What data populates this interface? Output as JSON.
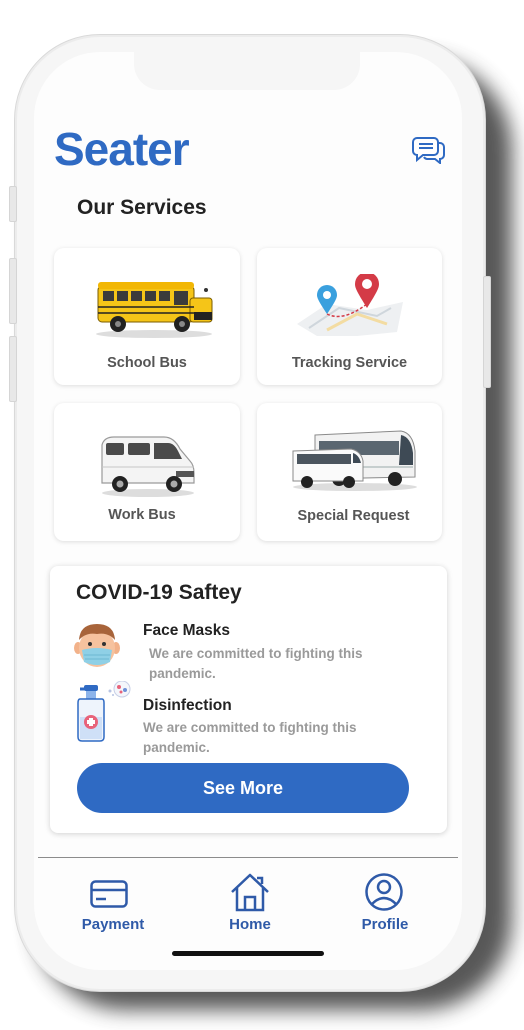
{
  "app": {
    "title": "Seater"
  },
  "header": {
    "chat_icon": "chat-bubbles-icon"
  },
  "services": {
    "title": "Our Services",
    "items": [
      {
        "label": "School Bus",
        "icon": "school-bus-image"
      },
      {
        "label": "Tracking Service",
        "icon": "map-pins-image"
      },
      {
        "label": "Work Bus",
        "icon": "van-image"
      },
      {
        "label": "Special Request",
        "icon": "coach-buses-image"
      }
    ]
  },
  "covid": {
    "title": "COVID-19 Saftey",
    "items": [
      {
        "title": "Face Masks",
        "desc": "We are committed to fighting this pandemic.",
        "icon": "masked-face-icon"
      },
      {
        "title": "Disinfection",
        "desc": "We are committed to fighting this pandemic.",
        "icon": "spray-bottle-icon"
      }
    ],
    "button_label": "See More"
  },
  "nav": {
    "items": [
      {
        "label": "Payment",
        "icon": "card-icon"
      },
      {
        "label": "Home",
        "icon": "house-icon"
      },
      {
        "label": "Profile",
        "icon": "user-circle-icon"
      }
    ]
  },
  "colors": {
    "brand": "#2f6ac3",
    "nav": "#2f5aa8",
    "muted_text": "#9a9a9a"
  }
}
